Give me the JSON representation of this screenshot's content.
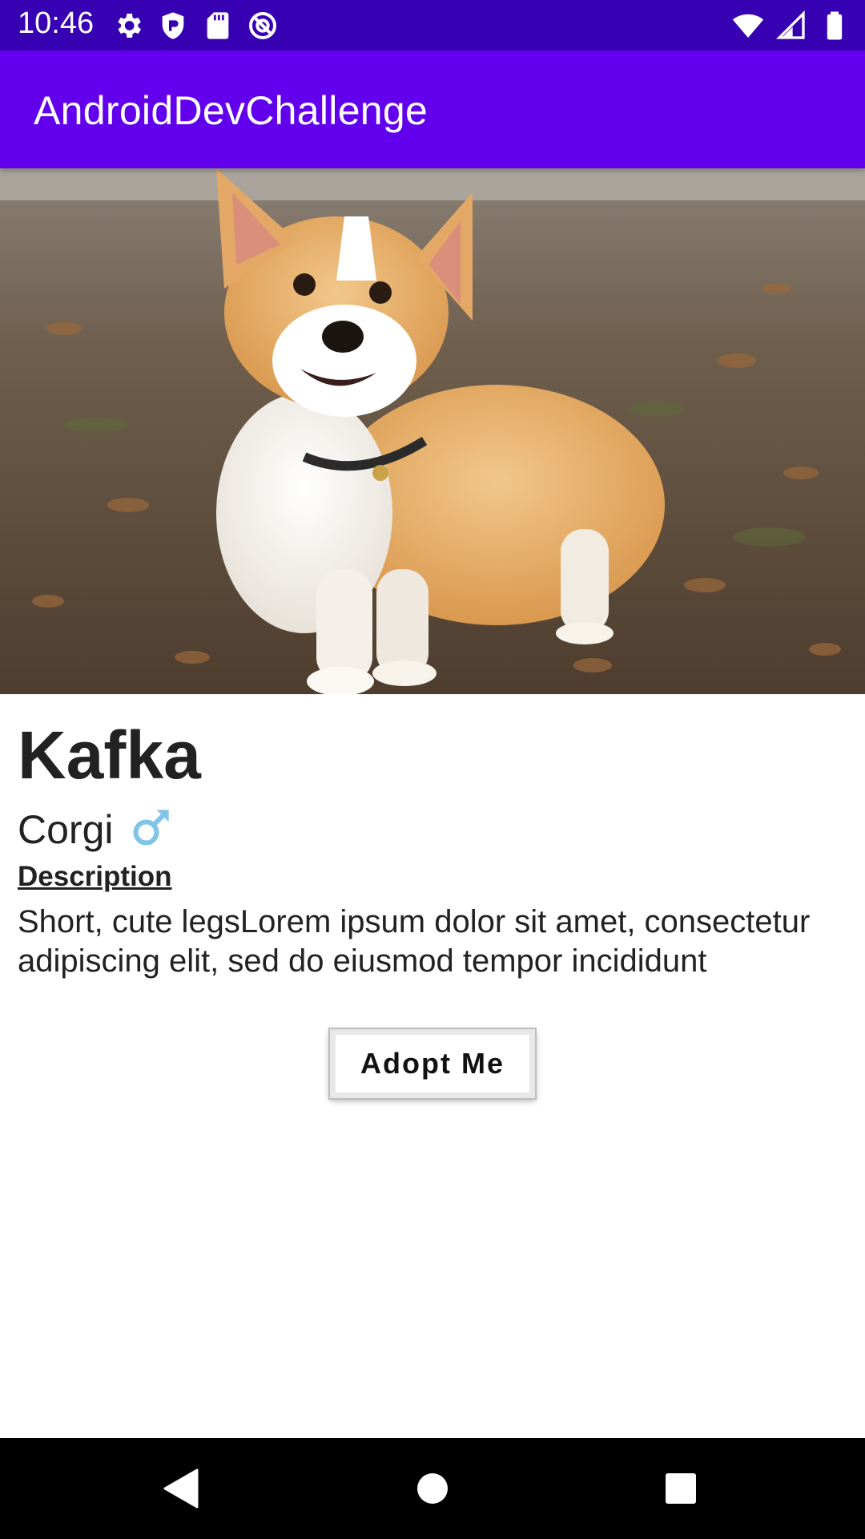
{
  "status_bar": {
    "time": "10:46",
    "icons_left": [
      "gear-icon",
      "shield-icon",
      "sd-card-icon",
      "at-sign-icon"
    ],
    "icons_right": [
      "wifi-icon",
      "signal-icon",
      "battery-icon"
    ]
  },
  "app_bar": {
    "title": "AndroidDevChallenge",
    "color": "#6200EE",
    "status_color": "#3700B3"
  },
  "pet": {
    "photo": "corgi-photo",
    "name": "Kafka",
    "breed": "Corgi",
    "gender_icon": "male-symbol-icon",
    "gender_color": "#81C4EA",
    "description_title": "Description",
    "description": "Short, cute legsLorem ipsum dolor sit amet, consectetur adipiscing elit, sed do eiusmod tempor incididunt"
  },
  "actions": {
    "adopt_label": "Adopt Me"
  },
  "nav_bar": {
    "buttons": [
      "back-icon",
      "home-icon",
      "recents-icon"
    ]
  }
}
